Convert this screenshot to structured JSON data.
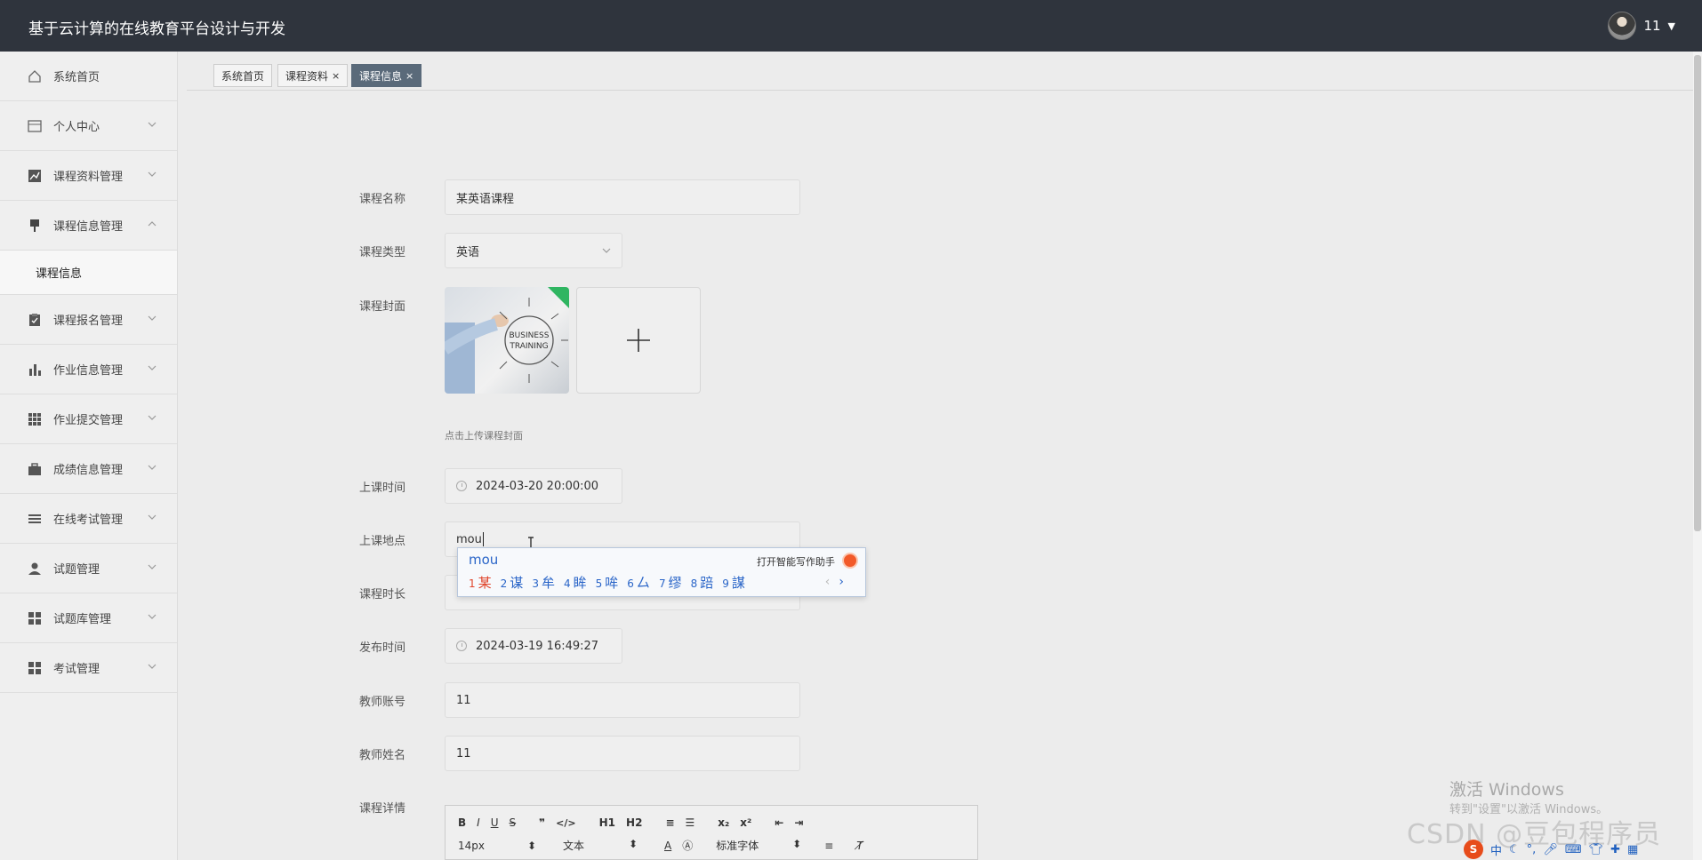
{
  "header": {
    "title": "基于云计算的在线教育平台设计与开发",
    "user_name": "11"
  },
  "sidebar": {
    "items": [
      {
        "label": "系统首页",
        "icon": "home-icon"
      },
      {
        "label": "个人中心",
        "icon": "card-icon"
      },
      {
        "label": "课程资料管理",
        "icon": "chart-icon"
      },
      {
        "label": "课程信息管理",
        "icon": "pin-icon",
        "sub": "课程信息"
      },
      {
        "label": "课程报名管理",
        "icon": "clipboard-icon"
      },
      {
        "label": "作业信息管理",
        "icon": "bar-chart-icon"
      },
      {
        "label": "作业提交管理",
        "icon": "grid-icon"
      },
      {
        "label": "成绩信息管理",
        "icon": "briefcase-icon"
      },
      {
        "label": "在线考试管理",
        "icon": "list-icon"
      },
      {
        "label": "试题管理",
        "icon": "user-icon"
      },
      {
        "label": "试题库管理",
        "icon": "apps-icon"
      },
      {
        "label": "考试管理",
        "icon": "apps-icon"
      }
    ]
  },
  "tabs": [
    {
      "label": "系统首页"
    },
    {
      "label": "课程资料",
      "close": "×"
    },
    {
      "label": "课程信息",
      "close": "×"
    }
  ],
  "form": {
    "course_name_label": "课程名称",
    "course_name_value": "某英语课程",
    "course_type_label": "课程类型",
    "course_type_value": "英语",
    "cover_label": "课程封面",
    "cover_image_text": [
      "BUSINESS",
      "TRAINING"
    ],
    "upload_hint": "点击上传课程封面",
    "class_time_label": "上课时间",
    "class_time_value": "2024-03-20 20:00:00",
    "location_label": "上课地点",
    "location_value": "mou",
    "duration_label": "课程时长",
    "publish_time_label": "发布时间",
    "publish_time_value": "2024-03-19 16:49:27",
    "teacher_account_label": "教师账号",
    "teacher_account_value": "11",
    "teacher_name_label": "教师姓名",
    "teacher_name_value": "11",
    "detail_label": "课程详情"
  },
  "ime": {
    "composition": "mou",
    "assistant": "打开智能写作助手",
    "candidates": [
      "某",
      "谋",
      "牟",
      "眸",
      "哞",
      "厶",
      "缪",
      "踣",
      "謀"
    ]
  },
  "editor": {
    "row1": [
      "B",
      "I",
      "U",
      "S",
      "❞",
      "</>",
      "H1",
      "H2",
      "≡",
      "☰",
      "x₂",
      "x²",
      "⇤",
      "⇥"
    ],
    "font_size": "14px",
    "block_type": "文本",
    "font_family": "标准字体"
  },
  "watermark": {
    "line1": "激活 Windows",
    "line2": "转到\"设置\"以激活 Windows。",
    "csdn": "CSDN @豆包程序员"
  },
  "tray": {
    "ime_mode": "中"
  }
}
